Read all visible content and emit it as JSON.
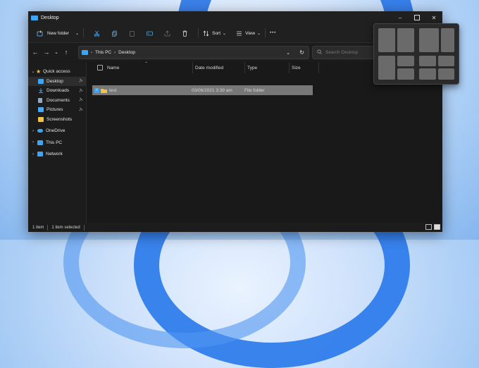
{
  "window": {
    "title": "Desktop"
  },
  "window_controls": {
    "minimize": "–",
    "close": "✕"
  },
  "toolbar": {
    "new_folder": "New folder",
    "new_folder_chevron": "⌄",
    "sort": "Sort",
    "sort_chevron": "⌄",
    "view": "View",
    "view_chevron": "⌄",
    "more": "•••"
  },
  "address": {
    "back": "←",
    "forward": "→",
    "recent": "⌄",
    "up": "↑",
    "crumb_root": "This PC",
    "sep1": "›",
    "crumb_current": "Desktop",
    "dropdown": "⌄",
    "refresh": "↻"
  },
  "search": {
    "placeholder": "Search Desktop"
  },
  "sidebar": {
    "quick_access": "Quick access",
    "items": [
      {
        "label": "Desktop",
        "pinned": true
      },
      {
        "label": "Downloads",
        "pinned": true
      },
      {
        "label": "Documents",
        "pinned": true
      },
      {
        "label": "Pictures",
        "pinned": true
      },
      {
        "label": "Screenshots",
        "pinned": false
      }
    ],
    "onedrive": "OneDrive",
    "thispc": "This PC",
    "network": "Network",
    "pin_glyph": "📌",
    "chev_open": "⌄",
    "chev_closed": "›",
    "star": "★"
  },
  "columns": {
    "name": "Name",
    "date": "Date modified",
    "type": "Type",
    "size": "Size",
    "sort_arrow": "⌃"
  },
  "files": [
    {
      "name": "test",
      "date": "03/06/2021 3:39 am",
      "type": "File folder",
      "size": ""
    }
  ],
  "status": {
    "count": "1 item",
    "selected": "1 item selected"
  },
  "colors": {
    "accent": "#3ea4f4",
    "folder": "#f3c24a"
  }
}
